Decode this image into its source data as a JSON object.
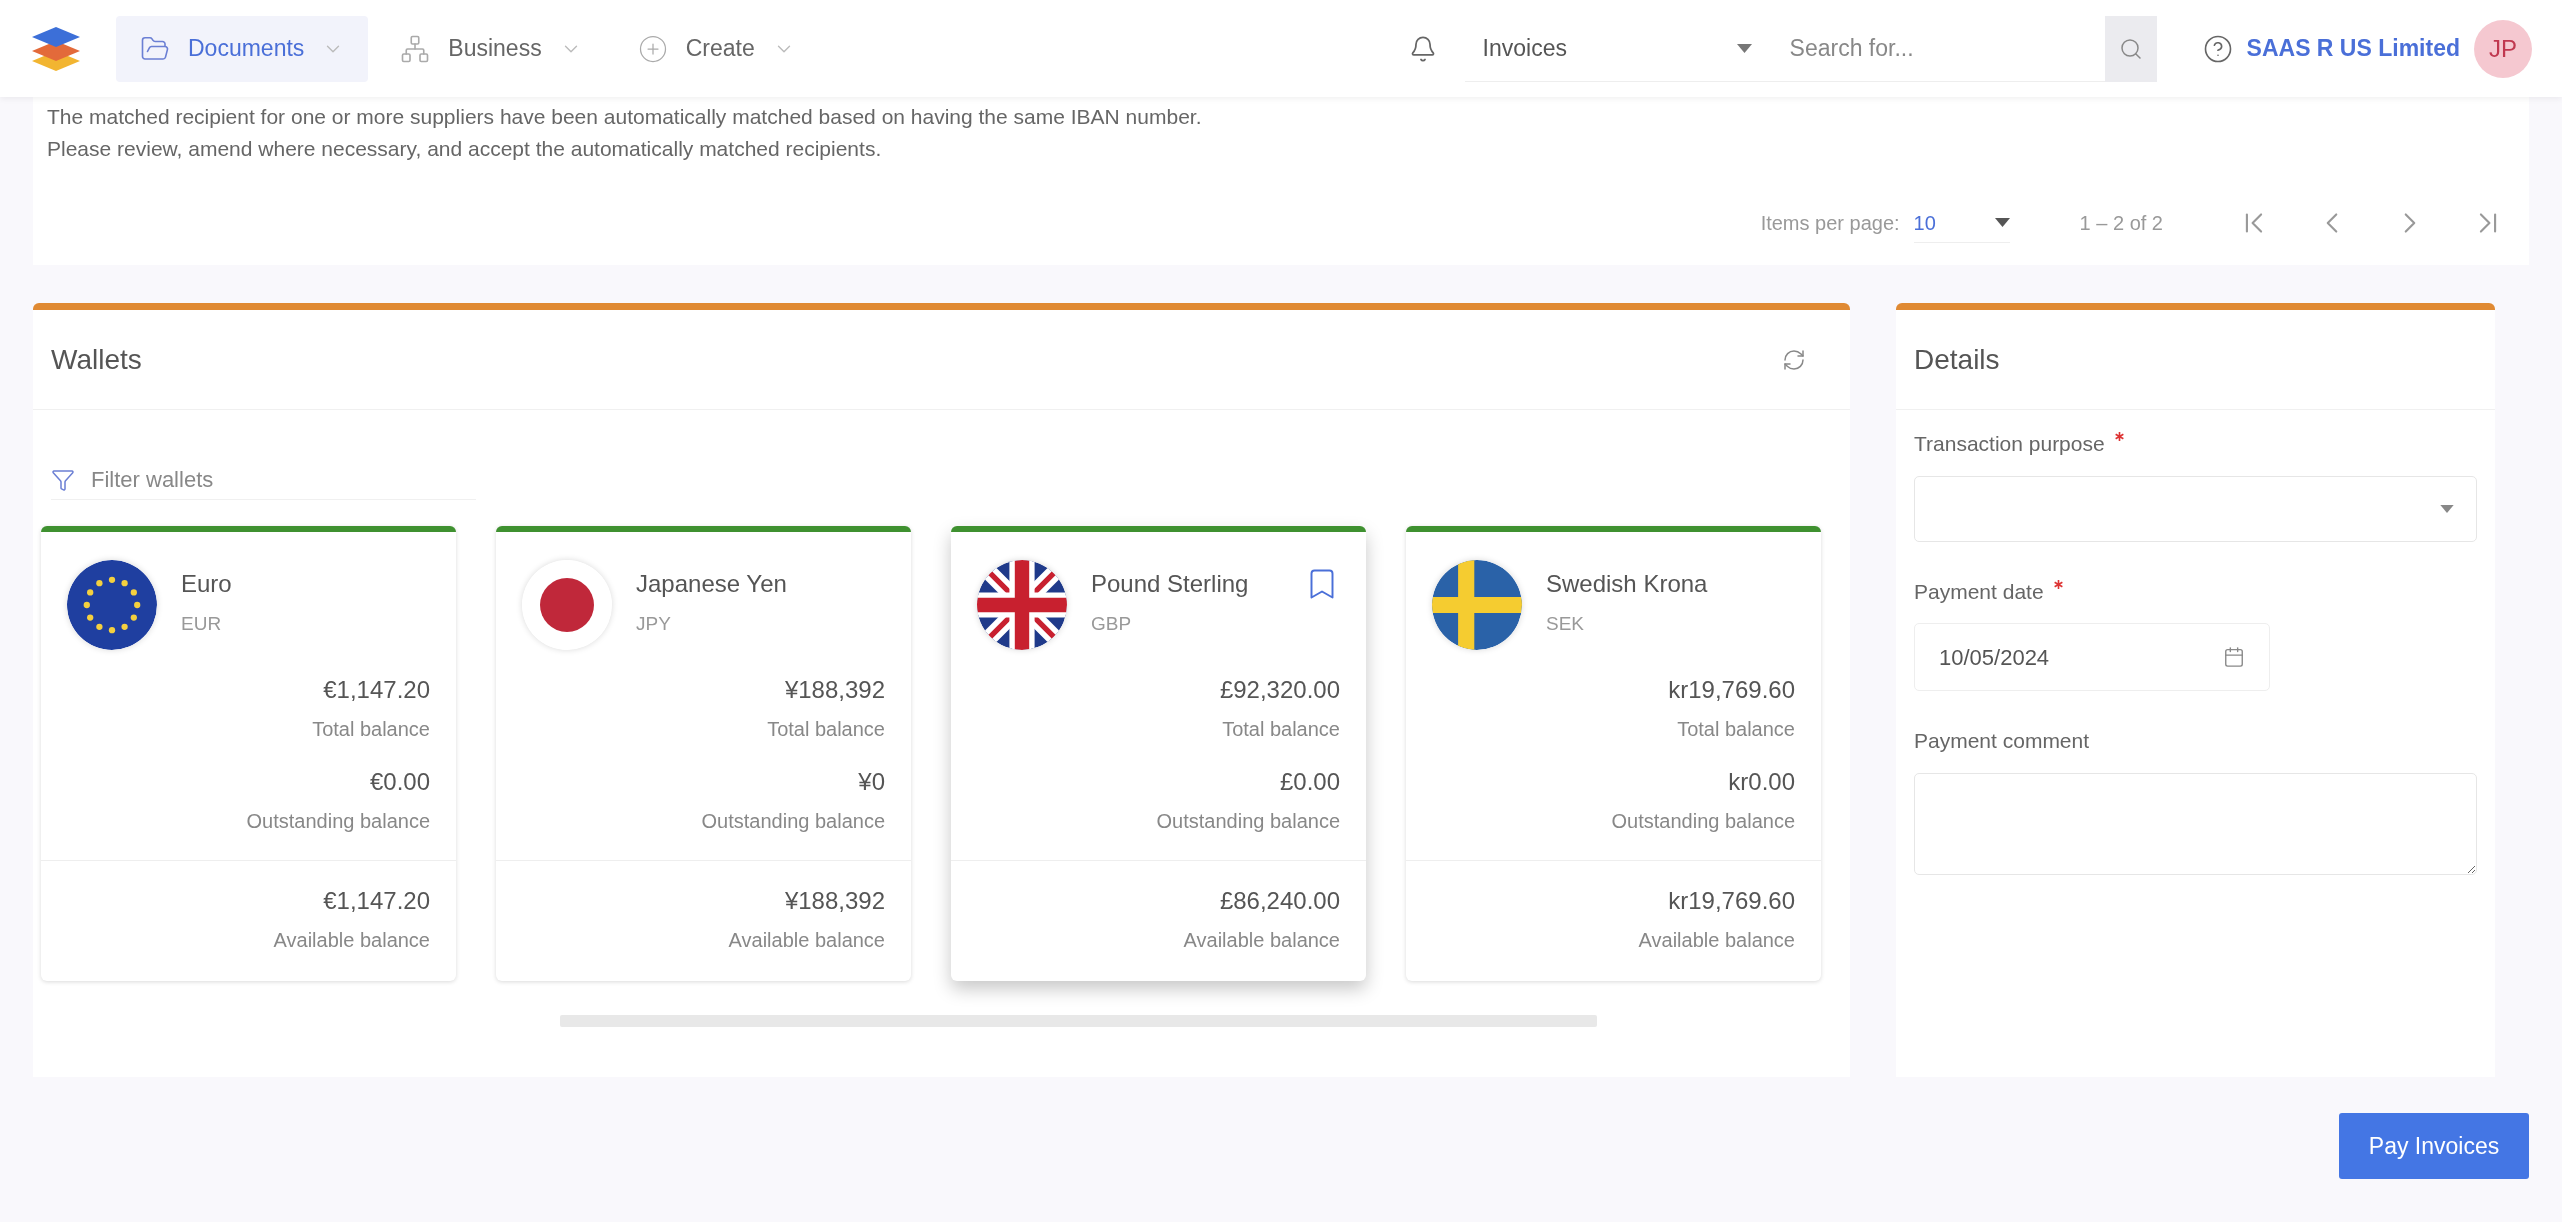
{
  "header": {
    "nav": [
      {
        "label": "Documents",
        "selected": true,
        "kind": "documents"
      },
      {
        "label": "Business",
        "selected": false,
        "kind": "business"
      },
      {
        "label": "Create",
        "selected": false,
        "kind": "create"
      }
    ],
    "module_select": {
      "value": "Invoices"
    },
    "search": {
      "placeholder": "Search for..."
    },
    "company": "SAAS R US Limited",
    "avatar": "JP"
  },
  "notice": {
    "lines": [
      "The matched recipient for one or more suppliers have been automatically matched based on having the same IBAN number.",
      "Please review, amend where necessary, and accept the automatically matched recipients."
    ]
  },
  "pagination": {
    "items_per_page_label": "Items per page:",
    "items_per_page": "10",
    "range": "1 – 2 of 2"
  },
  "wallets": {
    "title": "Wallets",
    "filter": {
      "placeholder": "Filter wallets"
    },
    "cards": [
      {
        "kind": "eu",
        "name": "Euro",
        "code": "EUR",
        "selected": false,
        "total": "€1,147.20",
        "total_label": "Total balance",
        "outstanding": "€0.00",
        "outstanding_label": "Outstanding balance",
        "available": "€1,147.20",
        "available_label": "Available balance"
      },
      {
        "kind": "jp",
        "name": "Japanese Yen",
        "code": "JPY",
        "selected": false,
        "total": "¥188,392",
        "total_label": "Total balance",
        "outstanding": "¥0",
        "outstanding_label": "Outstanding balance",
        "available": "¥188,392",
        "available_label": "Available balance"
      },
      {
        "kind": "gb",
        "name": "Pound Sterling",
        "code": "GBP",
        "selected": true,
        "total": "£92,320.00",
        "total_label": "Total balance",
        "outstanding": "£0.00",
        "outstanding_label": "Outstanding balance",
        "available": "£86,240.00",
        "available_label": "Available balance"
      },
      {
        "kind": "se",
        "name": "Swedish Krona",
        "code": "SEK",
        "selected": false,
        "total": "kr19,769.60",
        "total_label": "Total balance",
        "outstanding": "kr0.00",
        "outstanding_label": "Outstanding balance",
        "available": "kr19,769.60",
        "available_label": "Available balance"
      }
    ]
  },
  "details": {
    "title": "Details",
    "fields": [
      {
        "kind": "select",
        "label": "Transaction purpose",
        "required": true
      },
      {
        "kind": "date",
        "label": "Payment date",
        "required": true,
        "value": "10/05/2024"
      },
      {
        "kind": "textarea",
        "label": "Payment comment",
        "required": false
      }
    ]
  },
  "pay_button": "Pay Invoices"
}
